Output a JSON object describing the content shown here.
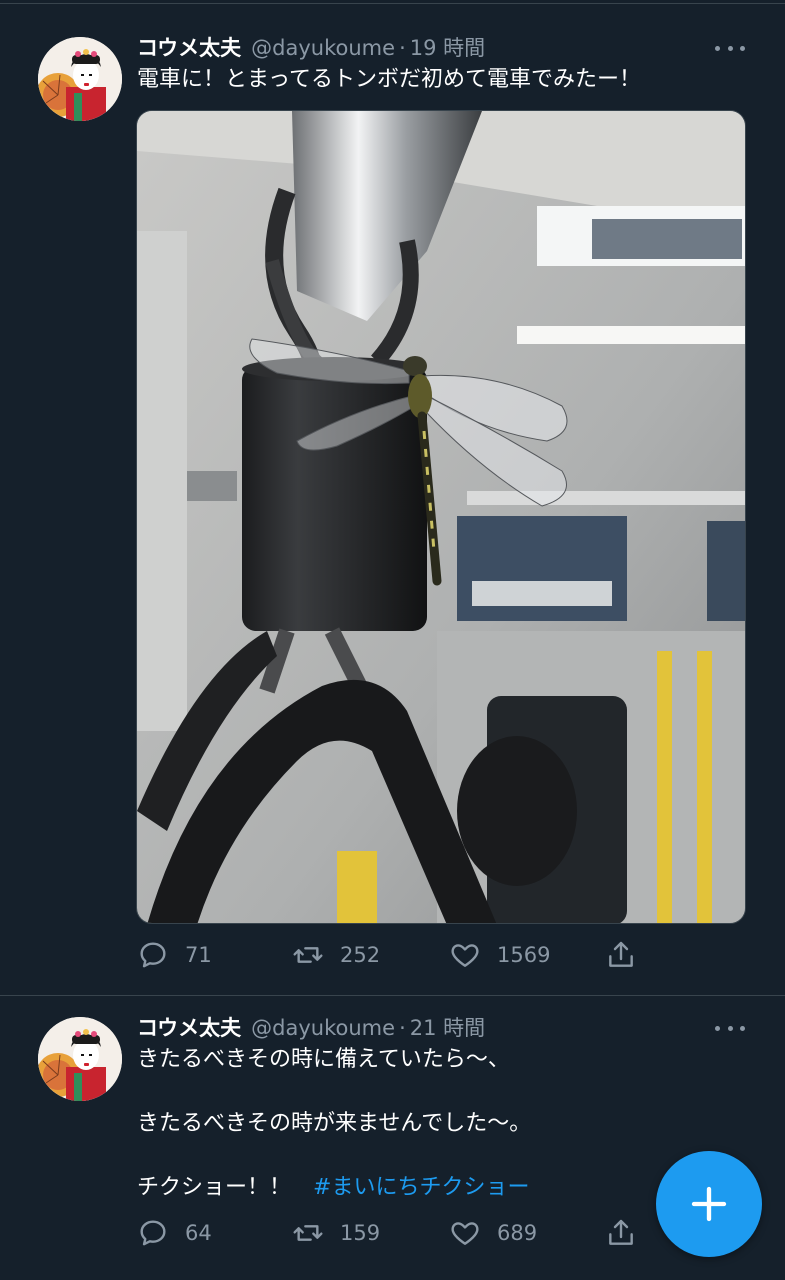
{
  "tweets": [
    {
      "author_name": "コウメ太夫",
      "handle": "@dayukoume",
      "separator": "·",
      "time": "19 時間",
      "text_lines": [
        "電車に！とまってるトンボだ初めて電車でみたー！"
      ],
      "photo_icon": "dragonfly-on-train-strap-photo",
      "actions": {
        "reply_count": "71",
        "retweet_count": "252",
        "like_count": "1569"
      }
    },
    {
      "author_name": "コウメ太夫",
      "handle": "@dayukoume",
      "separator": "·",
      "time": "21 時間",
      "text_lines": [
        "きたるべきその時に備えていたら〜、",
        "きたるべきその時が来ませんでした〜。",
        "チクショー！！"
      ],
      "hashtag": "#まいにちチクショー",
      "actions": {
        "reply_count": "64",
        "retweet_count": "159",
        "like_count": "689"
      }
    }
  ],
  "icons": {
    "reply": "reply-icon",
    "retweet": "retweet-icon",
    "like": "heart-icon",
    "share": "share-icon",
    "more": "more-icon",
    "compose": "plus-icon"
  },
  "colors": {
    "background": "#15202b",
    "accent": "#1d9bf0",
    "muted": "#8b98a5"
  }
}
